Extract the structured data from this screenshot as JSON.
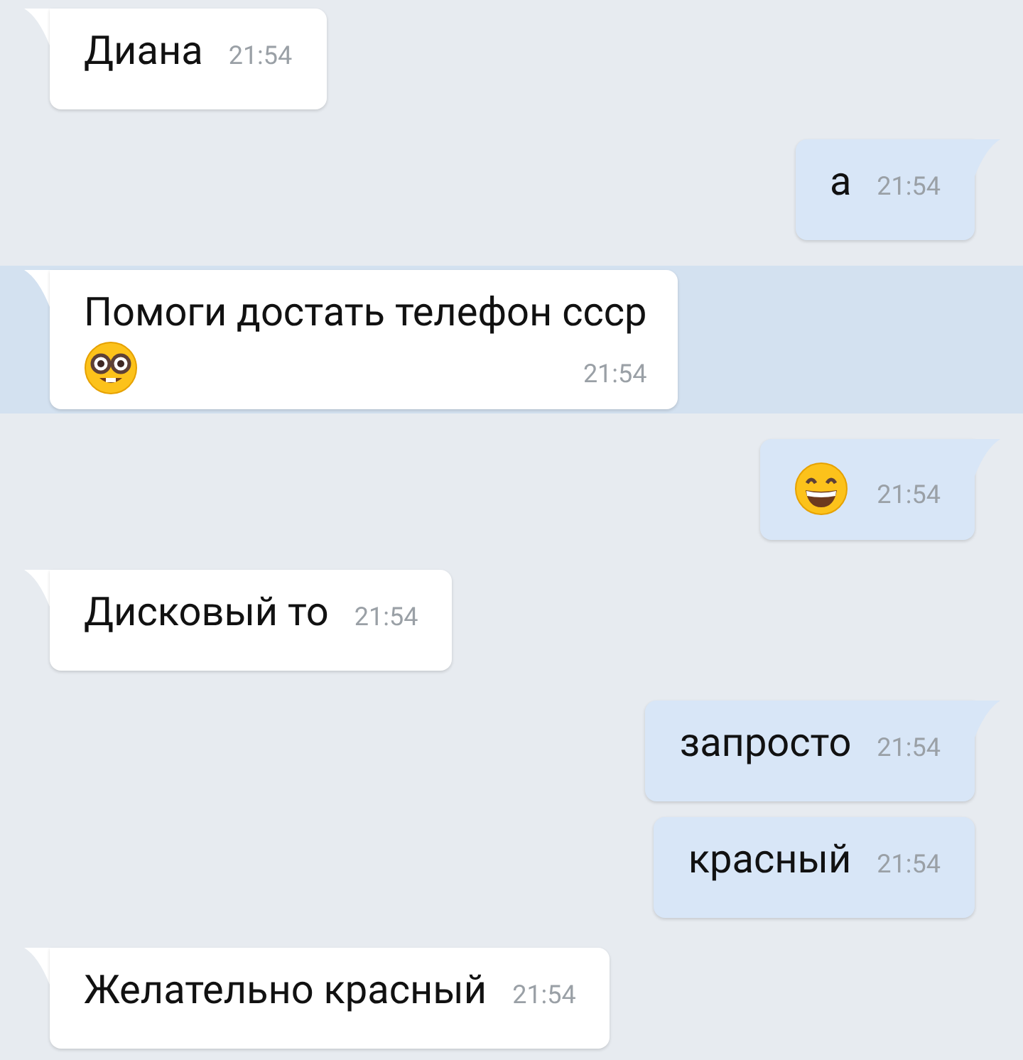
{
  "messages": [
    {
      "outgoing": false,
      "tail": true,
      "selected": false,
      "kind": "text",
      "text": "Диана",
      "time": "21:54"
    },
    {
      "outgoing": true,
      "tail": true,
      "selected": false,
      "kind": "text",
      "text": "а",
      "time": "21:54"
    },
    {
      "outgoing": false,
      "tail": true,
      "selected": true,
      "kind": "text_and_emoji",
      "text": "Помоги достать телефон ссср",
      "time": "21:54"
    },
    {
      "outgoing": true,
      "tail": true,
      "selected": false,
      "kind": "emoji",
      "time": "21:54"
    },
    {
      "outgoing": false,
      "tail": true,
      "selected": false,
      "kind": "text",
      "text": "Дисковый то",
      "time": "21:54"
    },
    {
      "outgoing": true,
      "tail": true,
      "selected": false,
      "kind": "text",
      "text": "запросто",
      "time": "21:54"
    },
    {
      "outgoing": true,
      "tail": false,
      "selected": false,
      "kind": "text",
      "text": "красный",
      "time": "21:54"
    },
    {
      "outgoing": false,
      "tail": true,
      "selected": false,
      "kind": "text",
      "text": "Желательно красный",
      "time": "21:54"
    }
  ]
}
